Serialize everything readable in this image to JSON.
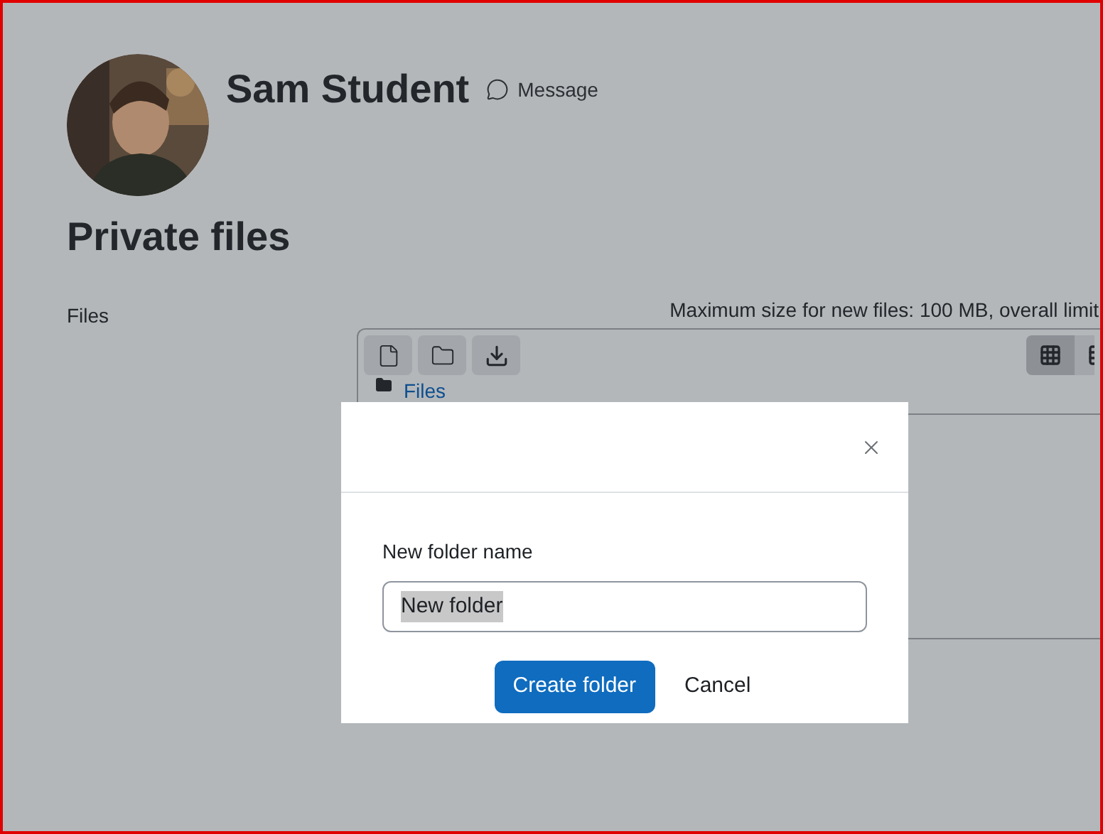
{
  "profile": {
    "name": "Sam Student",
    "message_link": "Message"
  },
  "page_title": "Private files",
  "files_label": "Files",
  "max_size_text": "Maximum size for new files: 100 MB, overall limit",
  "view_modes": [
    {
      "selected": true
    },
    {
      "selected": false
    }
  ],
  "breadcrumb": "Files",
  "dialog": {
    "field_label": "New folder name",
    "field_value": "New folder",
    "value_selected": true,
    "buttons": [
      {
        "kind": "primary",
        "label": "Create folder"
      },
      {
        "kind": "secondary",
        "label": "Cancel"
      }
    ]
  }
}
